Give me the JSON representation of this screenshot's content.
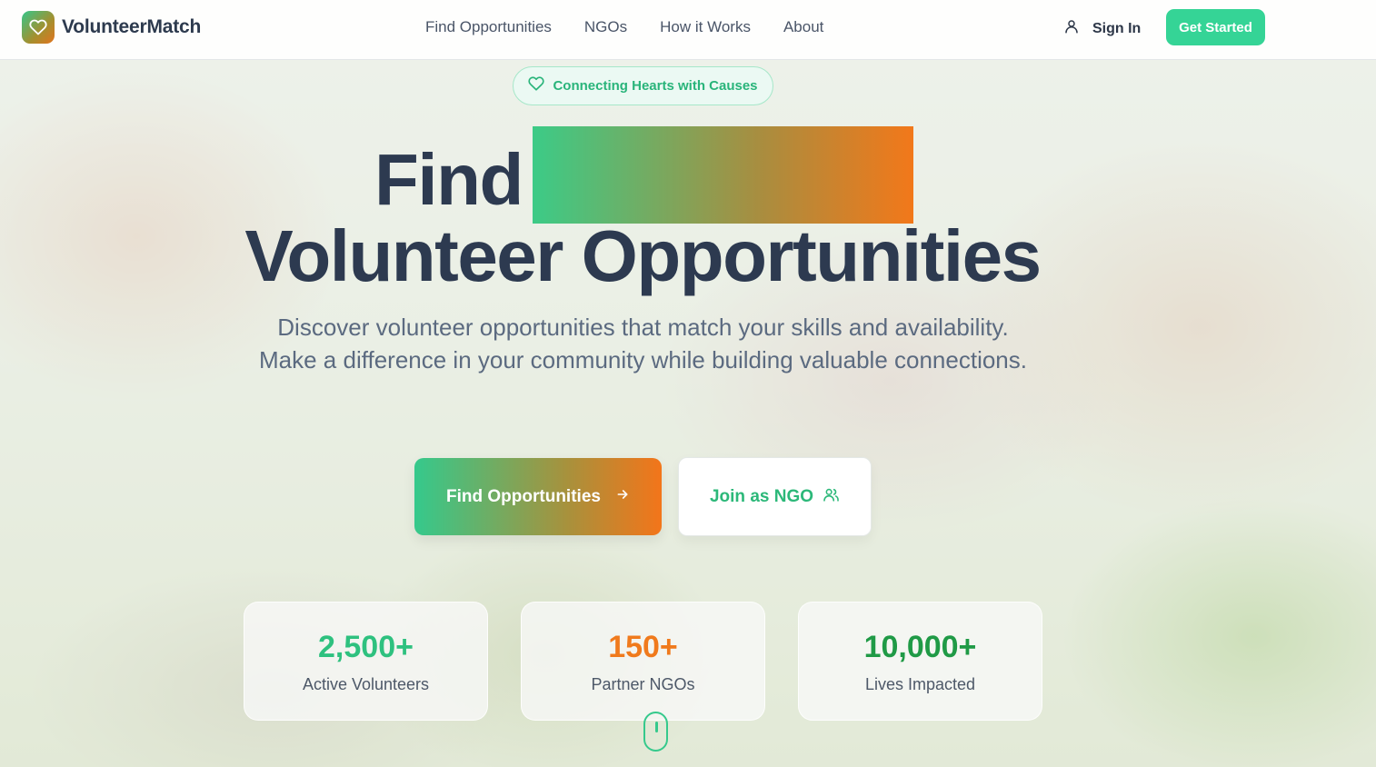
{
  "brand": {
    "name": "VolunteerMatch",
    "icon": "heart-icon"
  },
  "nav": {
    "links": [
      "Find Opportunities",
      "NGOs",
      "How it Works",
      "About"
    ],
    "signin_label": "Sign In",
    "signin_icon": "user-icon",
    "get_started_label": "Get Started"
  },
  "hero": {
    "badge_text": "Connecting Hearts with Causes",
    "badge_icon": "heart-icon",
    "title_line1": "Find",
    "title_line2": "Volunteer Opportunities",
    "subtitle": "Discover volunteer opportunities that match your skills and availability. Make a difference in your community while building valuable connections.",
    "primary_cta": "Find Opportunities",
    "primary_cta_icon": "arrow-right-icon",
    "secondary_cta": "Join as NGO",
    "secondary_cta_icon": "users-icon"
  },
  "stats": [
    {
      "value": "2,500+",
      "label": "Active Volunteers",
      "color": "#2ec17f"
    },
    {
      "value": "150+",
      "label": "Partner NGOs",
      "color": "#f07a1c"
    },
    {
      "value": "10,000+",
      "label": "Lives Impacted",
      "color": "#1f9a46"
    }
  ],
  "colors": {
    "accent_green": "#35d496",
    "accent_orange": "#f2781a",
    "heading": "#2d3a50"
  }
}
